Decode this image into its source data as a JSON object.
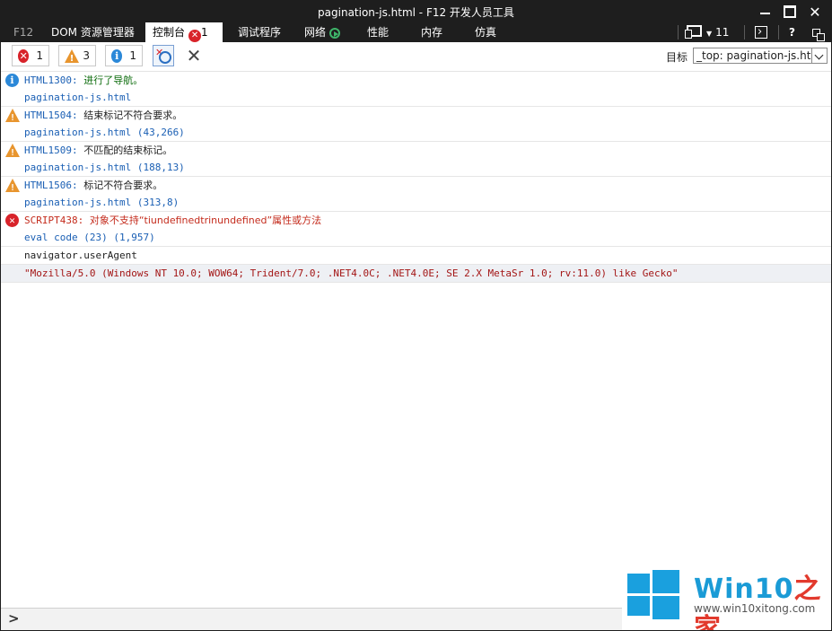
{
  "window": {
    "title": "pagination-js.html - F12 开发人员工具"
  },
  "tabs": [
    {
      "label": "F12"
    },
    {
      "label": "DOM 资源管理器"
    },
    {
      "label": "控制台",
      "error_count": "1"
    },
    {
      "label": "调试程序"
    },
    {
      "label": "网络"
    },
    {
      "label": "性能"
    },
    {
      "label": "内存"
    },
    {
      "label": "仿真"
    }
  ],
  "tabbar_right": {
    "emulation_count": "11",
    "help": "?"
  },
  "toolbar": {
    "error_count": "1",
    "warning_count": "3",
    "info_count": "1",
    "target_label": "目标",
    "target_value": "_top: pagination-js.html"
  },
  "messages": [
    {
      "type": "info",
      "code": "HTML1300:",
      "text": "进行了导航。",
      "location": "pagination-js.html"
    },
    {
      "type": "warning",
      "code": "HTML1504:",
      "text": "结束标记不符合要求。",
      "location": "pagination-js.html (43,266)"
    },
    {
      "type": "warning",
      "code": "HTML1509:",
      "text": "不匹配的结束标记。",
      "location": "pagination-js.html (188,13)"
    },
    {
      "type": "warning",
      "code": "HTML1506:",
      "text": "标记不符合要求。",
      "location": "pagination-js.html (313,8)"
    },
    {
      "type": "error",
      "code": "SCRIPT438:",
      "text": "对象不支持“tiundefinedtrinundefined”属性或方法",
      "location": "eval code (23) (1,957)"
    }
  ],
  "console_input": "navigator.userAgent",
  "console_result": "\"Mozilla/5.0 (Windows NT 10.0; WOW64; Trident/7.0; .NET4.0C; .NET4.0E; SE 2.X MetaSr 1.0; rv:11.0) like Gecko\"",
  "command_prompt": ">",
  "watermark": {
    "brand_a": "Win10",
    "brand_b": "之家",
    "url": "www.win10xitong.com"
  },
  "colors": {
    "error": "#d8232a",
    "warning": "#e8952e",
    "info": "#2b88d8",
    "chrome_bg": "#1e1e1e",
    "watermark_blue": "#1aa0de"
  }
}
